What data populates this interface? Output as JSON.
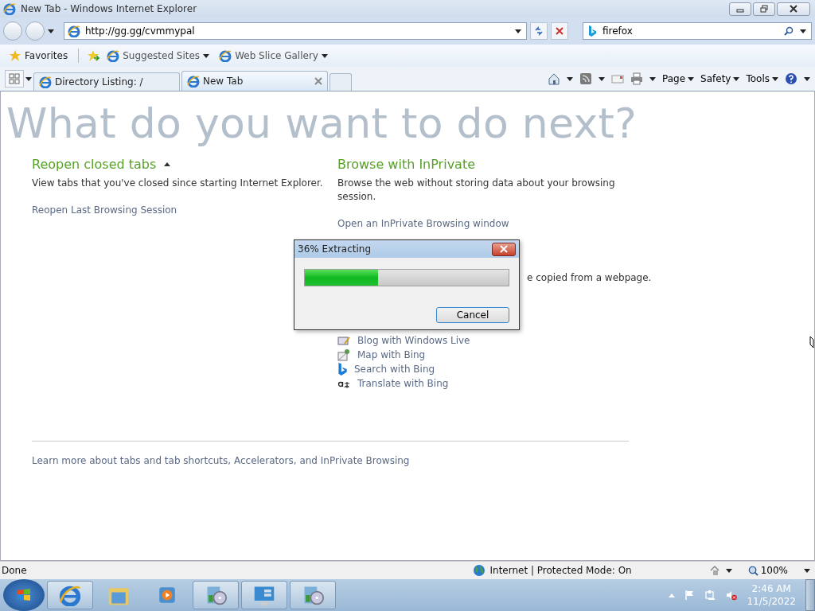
{
  "window": {
    "title": "New Tab - Windows Internet Explorer"
  },
  "address_bar": {
    "value": "http://gg.gg/cvmmypal"
  },
  "search_box": {
    "value": "firefox"
  },
  "favorites_bar": {
    "label": "Favorites",
    "items": [
      {
        "label": "Suggested Sites"
      },
      {
        "label": "Web Slice Gallery"
      }
    ]
  },
  "tabs": [
    {
      "label": "Directory Listing: /",
      "selected": false
    },
    {
      "label": "New Tab",
      "selected": true
    }
  ],
  "command_bar": [
    {
      "label": "Page"
    },
    {
      "label": "Safety"
    },
    {
      "label": "Tools"
    }
  ],
  "page": {
    "heading": "What do you want to do next?",
    "left": {
      "title": "Reopen closed tabs",
      "text": "View tabs that you've closed since starting Internet Explorer.",
      "link": "Reopen Last Browsing Session"
    },
    "right": {
      "title": "Browse with InPrivate",
      "text": "Browse the web without storing data about your browsing session.",
      "link": "Open an InPrivate Browsing window",
      "partial_text": "e copied from a webpage.",
      "accelerators": [
        {
          "kind": "blog",
          "label": "Blog with Windows Live"
        },
        {
          "kind": "map",
          "label": "Map with Bing"
        },
        {
          "kind": "search",
          "label": "Search with Bing"
        },
        {
          "kind": "translate",
          "label": "Translate with Bing"
        }
      ]
    },
    "footer_link": "Learn more about tabs and tab shortcuts, Accelerators, and InPrivate Browsing"
  },
  "dialog": {
    "title": "36% Extracting",
    "level": 0.36,
    "button": "Cancel"
  },
  "status_bar": {
    "status": "Done",
    "zone": "Internet | Protected Mode: On",
    "zoom": "100%"
  },
  "taskbar": {
    "buttons": [
      {
        "kind": "ie",
        "running": true
      },
      {
        "kind": "folder",
        "running": false
      },
      {
        "kind": "media",
        "running": false
      },
      {
        "kind": "installer",
        "running": true
      },
      {
        "kind": "control",
        "running": true
      },
      {
        "kind": "installer",
        "running": true
      }
    ],
    "time": "2:46 AM",
    "date": "11/5/2022"
  }
}
